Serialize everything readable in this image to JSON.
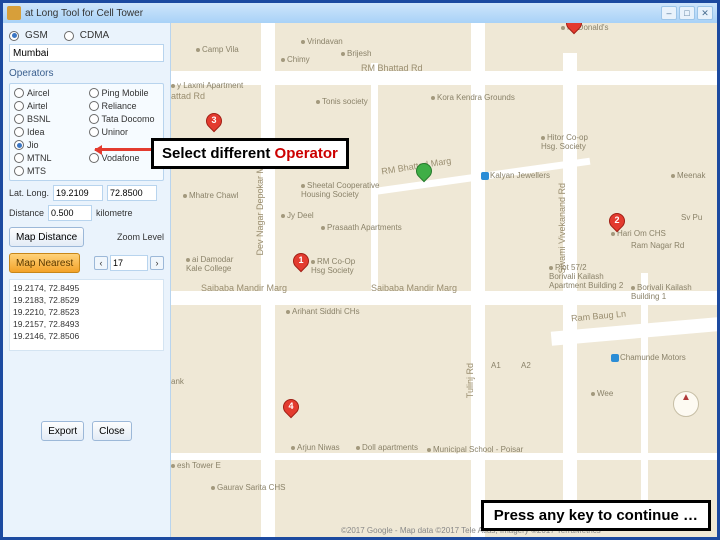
{
  "window": {
    "title": "at Long Tool for Cell Tower",
    "min": "–",
    "max": "□",
    "close": "✕"
  },
  "standards": {
    "gsm": "GSM",
    "cdma": "CDMA"
  },
  "city": "Mumbai",
  "operators": {
    "title": "Operators",
    "list": [
      {
        "name": "Aircel"
      },
      {
        "name": "Ping Mobile"
      },
      {
        "name": "Airtel"
      },
      {
        "name": "Reliance"
      },
      {
        "name": "BSNL"
      },
      {
        "name": "Tata Docomo"
      },
      {
        "name": "Idea"
      },
      {
        "name": "Uninor"
      },
      {
        "name": "Jio"
      },
      {
        "name": ""
      },
      {
        "name": "MTNL"
      },
      {
        "name": "Vodafone"
      },
      {
        "name": "MTS"
      }
    ]
  },
  "latlong": {
    "label": "Lat. Long.",
    "lat": "19.2109",
    "lon": "72.8500"
  },
  "distance": {
    "label": "Distance",
    "value": "0.500",
    "unit": "kilometre"
  },
  "buttons": {
    "map_distance": "Map Distance",
    "map_nearest": "Map Nearest",
    "export": "Export",
    "close": "Close"
  },
  "zoom": {
    "label": "Zoom Level",
    "value": "17"
  },
  "coords": [
    "19.2174, 72.8495",
    "19.2183, 72.8529",
    "19.2210, 72.8523",
    "19.2157, 72.8493",
    "19.2146, 72.8506"
  ],
  "map_labels": {
    "bhattad": "RM Bhattad Rd",
    "bhattad2": "attad Rd",
    "saibaba": "Saibaba Mandir Marg",
    "saibaba2": "Saibaba Mandir Marg",
    "brahm": "RM Bhattad Marg",
    "ram_bhog": "Ram Baug Ln",
    "swami": "Swami Vivekanand Rd",
    "deyn": "Dev Nagar Depokar Marg",
    "tulinj": "Tulinj Rd"
  },
  "pois": {
    "mcdonalds": "McDonald's",
    "vrindavan": "Vrindavan",
    "camp": "Camp Vila",
    "chimy": "Chimy",
    "brijesh": "Brijesh",
    "laxmi": "y Laxmi Apartment",
    "tonis": "Tonis society",
    "kora": "Kora Kendra Grounds",
    "hitor": "Hitor Co-op\nHsg. Society",
    "kalyan": "Kalyan Jewellers",
    "meenak": "Meenak",
    "mhatre": "Mhatre Chawl",
    "sheetal": "Sheetal Cooperative\nHousing Society",
    "jydeel": "Jy Deel",
    "prasath": "Prasaath Apartments",
    "hariom": "Hari Om CHS",
    "damodar": "ai Damodar\nKale College",
    "rmcoop": "RM Co-Op\nHsg Society",
    "plot57": "Plot 57/2\nBorivali Kailash\nApartment Building 2",
    "arihant": "Arihant Siddhi CHs",
    "borivali": "Borivali Kailash\nBuilding 1",
    "chamunde": "Chamunde Motors",
    "sypu": "Sv Pu",
    "ram_nagar": "Ram Nagar Rd",
    "a1": "A1",
    "a2": "A2",
    "ank": "ank",
    "arjun": "Arjun Niwas",
    "doll": "Doll apartments",
    "municipal": "Municipal School - Poisar",
    "poisar": "Wee",
    "esh": "esh Tower E",
    "gaurav": "Gaurav Sarita CHS"
  },
  "callouts": {
    "select_pre": "Select different ",
    "select_word": "Operator",
    "continue": "Press any key to continue …"
  },
  "attribution": "©2017 Google - Map data ©2017 Tele Atlas, Imagery ©2017 TerraMetrics"
}
